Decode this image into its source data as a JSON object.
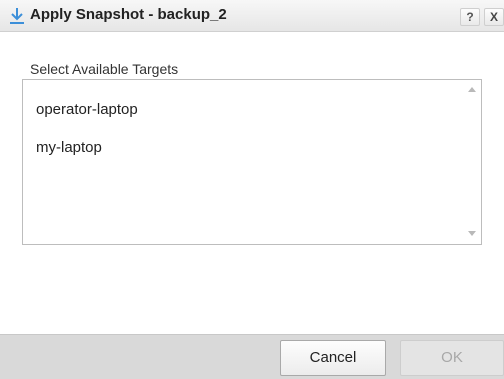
{
  "window": {
    "title": "Apply Snapshot - backup_2",
    "title_icon": "download-icon",
    "help_label": "?",
    "close_label": "X"
  },
  "targets": {
    "label": "Select Available Targets",
    "items": [
      "operator-laptop",
      "my-laptop"
    ]
  },
  "footer": {
    "cancel_label": "Cancel",
    "ok_label": "OK",
    "ok_enabled": false
  },
  "colors": {
    "icon_accent": "#3c8fd9",
    "footer_bg": "#d9d9d9",
    "disabled_text": "#a8a8a8"
  }
}
